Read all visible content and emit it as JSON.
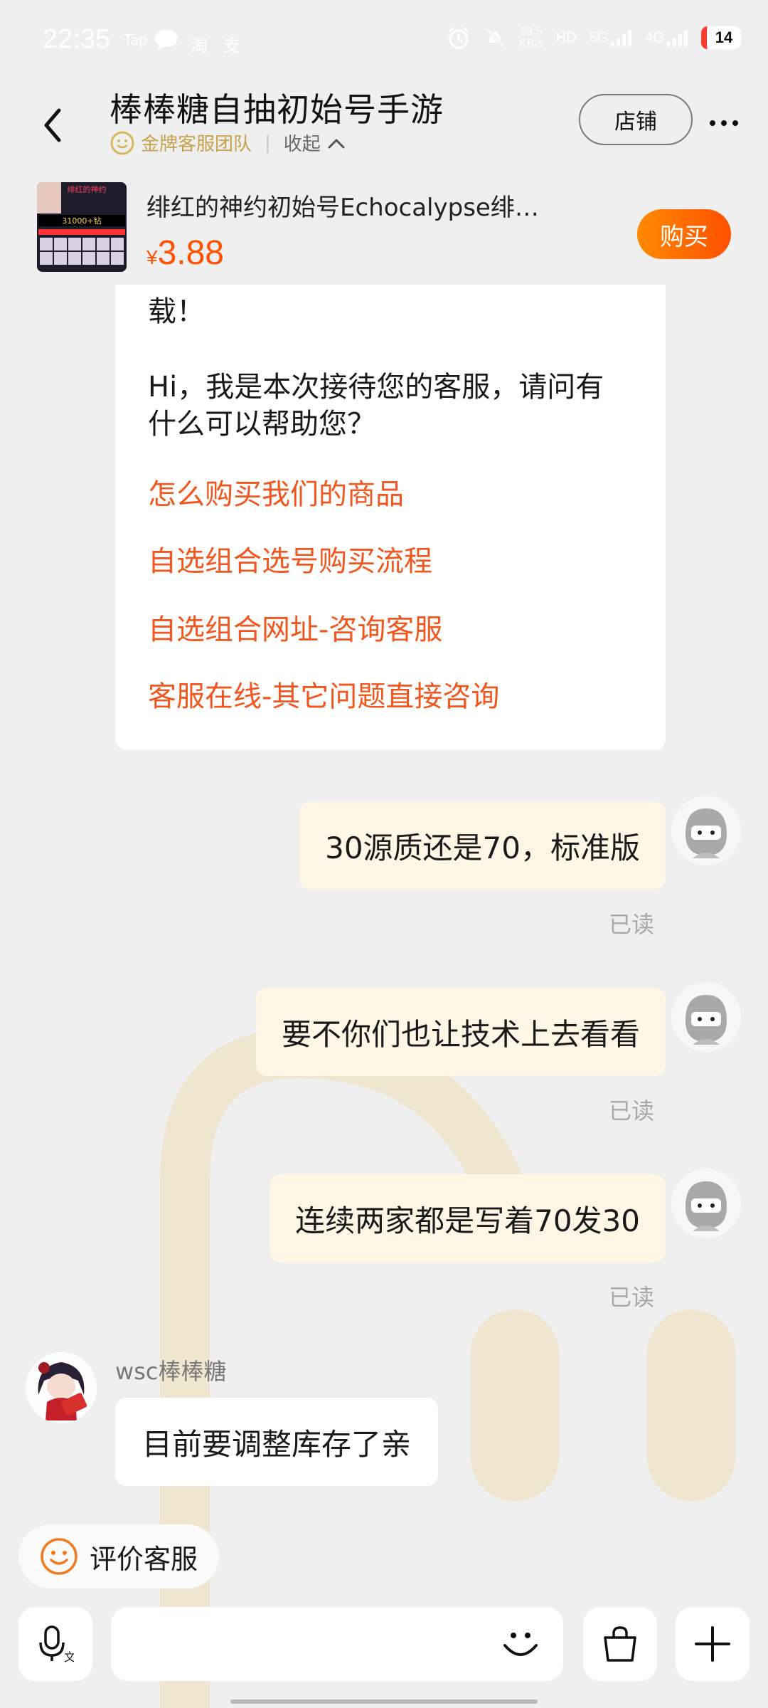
{
  "status_bar": {
    "time": "22:35",
    "app_tap": "Tap",
    "app_taobao": "淘",
    "app_other": "支",
    "net_speed_value": "23.5",
    "net_speed_unit": "KB/s",
    "hd": "HD",
    "net_5g": "5G",
    "net_4g": "4G",
    "battery": "14"
  },
  "header": {
    "title": "棒棒糖自抽初始号手游",
    "team_label": "金牌客服团队",
    "collapse_label": "收起",
    "store_button": "店铺"
  },
  "product": {
    "name": "绯红的神约初始号Echocalypse绯…",
    "currency": "¥",
    "price": "3.88",
    "buy_button": "购买",
    "thumb_text_1": "绯红的神约",
    "thumb_text_2": "31000+钻"
  },
  "bot_card": {
    "tail_text": "载！",
    "greeting": "Hi，我是本次接待您的客服，请问有什么可以帮助您？",
    "links": [
      "怎么购买我们的商品",
      "自选组合选号购买流程",
      "自选组合网址-咨询客服",
      "客服在线-其它问题直接咨询"
    ]
  },
  "my_messages": [
    {
      "text": "30源质还是70，标准版",
      "status": "已读"
    },
    {
      "text": "要不你们也让技术上去看看",
      "status": "已读"
    },
    {
      "text": "连续两家都是写着70发30",
      "status": "已读"
    }
  ],
  "seller": {
    "name": "wsc棒棒糖",
    "message": "目前要调整库存了亲"
  },
  "bottom": {
    "rate_button": "评价客服",
    "input_placeholder": ""
  },
  "colors": {
    "accent_orange": "#ff5000",
    "link_orange": "#f0571e",
    "my_bubble": "#fff6e6",
    "gold": "#c8a24a"
  }
}
